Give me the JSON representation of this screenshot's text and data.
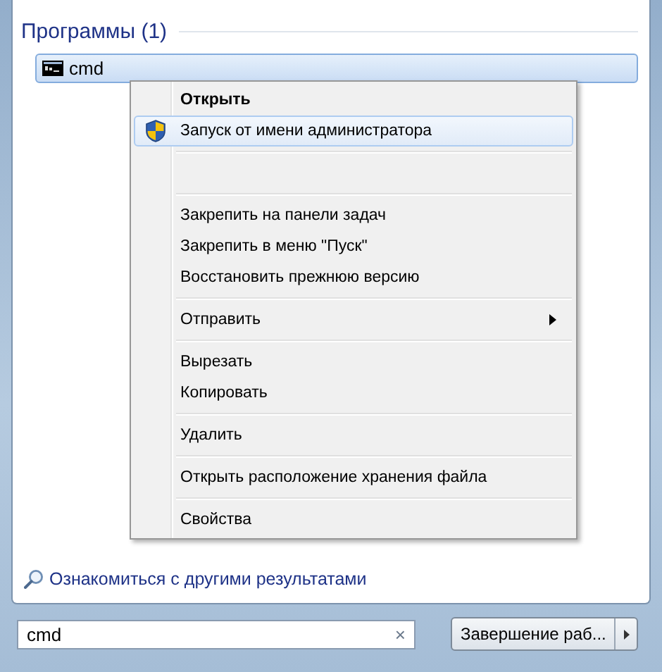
{
  "results": {
    "heading": "Программы (1)",
    "items": [
      {
        "label": "cmd",
        "selected": true
      }
    ]
  },
  "context_menu": {
    "items": [
      {
        "kind": "default",
        "label": "Открыть",
        "selected": false
      },
      {
        "kind": "shield_item",
        "label": "Запуск от имени администратора",
        "selected": true
      },
      {
        "kind": "separator"
      },
      {
        "kind": "blank"
      },
      {
        "kind": "separator"
      },
      {
        "kind": "item",
        "label": "Закрепить на панели задач",
        "selected": false
      },
      {
        "kind": "item",
        "label": "Закрепить в меню \"Пуск\"",
        "selected": false
      },
      {
        "kind": "item",
        "label": "Восстановить прежнюю версию",
        "selected": false
      },
      {
        "kind": "separator"
      },
      {
        "kind": "submenu",
        "label": "Отправить",
        "selected": false
      },
      {
        "kind": "separator"
      },
      {
        "kind": "item",
        "label": "Вырезать",
        "selected": false
      },
      {
        "kind": "item",
        "label": "Копировать",
        "selected": false
      },
      {
        "kind": "separator"
      },
      {
        "kind": "item",
        "label": "Удалить",
        "selected": false
      },
      {
        "kind": "separator"
      },
      {
        "kind": "item",
        "label": "Открыть расположение хранения файла",
        "selected": false
      },
      {
        "kind": "separator"
      },
      {
        "kind": "item",
        "label": "Свойства",
        "selected": false
      }
    ]
  },
  "more_results": "Ознакомиться с другими результатами",
  "search": {
    "value": "cmd",
    "clear": "×"
  },
  "shutdown": {
    "label": "Завершение раб..."
  }
}
